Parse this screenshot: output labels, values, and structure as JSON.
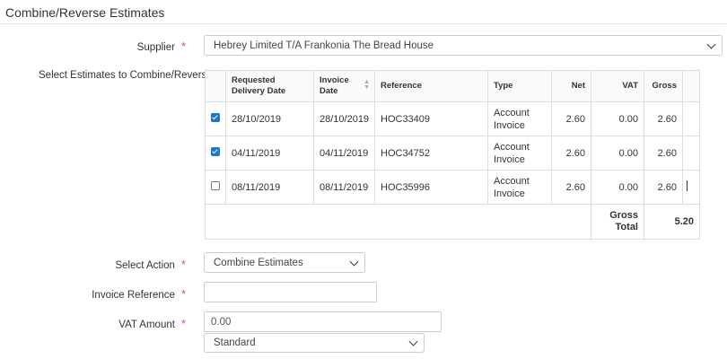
{
  "page_title": "Combine/Reverse Estimates",
  "supplier": {
    "label": "Supplier",
    "value": "Hebrey Limited T/A Frankonia The Bread House"
  },
  "estimates": {
    "label": "Select Estimates to Combine/Reverse",
    "columns": [
      "Requested Delivery Date",
      "Invoice Date",
      "Reference",
      "Type",
      "Net",
      "VAT",
      "Gross"
    ],
    "rows": [
      {
        "checked": true,
        "delivery": "28/10/2019",
        "invoice": "28/10/2019",
        "reference": "HOC33409",
        "type": "Account Invoice",
        "net": "2.60",
        "vat": "0.00",
        "gross": "2.60"
      },
      {
        "checked": true,
        "delivery": "04/11/2019",
        "invoice": "04/11/2019",
        "reference": "HOC34752",
        "type": "Account Invoice",
        "net": "2.60",
        "vat": "0.00",
        "gross": "2.60"
      },
      {
        "checked": false,
        "delivery": "08/11/2019",
        "invoice": "08/11/2019",
        "reference": "HOC35996",
        "type": "Account Invoice",
        "net": "2.60",
        "vat": "0.00",
        "gross": "2.60"
      }
    ],
    "total_label": "Gross Total",
    "total_value": "5.20"
  },
  "select_action": {
    "label": "Select Action",
    "value": "Combine Estimates"
  },
  "invoice_reference": {
    "label": "Invoice Reference",
    "value": ""
  },
  "vat_amount": {
    "label": "VAT Amount",
    "value": "0.00",
    "rate": "Standard"
  },
  "colors": {
    "required": "#d9534f",
    "checkbox": "#1976d2"
  }
}
